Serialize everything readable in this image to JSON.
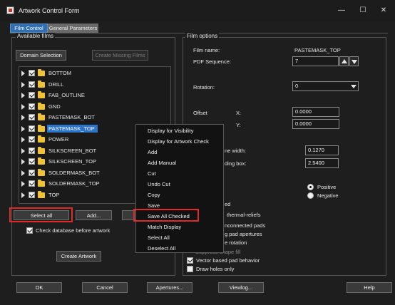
{
  "window": {
    "title": "Artwork Control Form",
    "minimize": "—",
    "maximize": "☐",
    "close": "✕"
  },
  "tabs": [
    "Film Control",
    "General Parameters"
  ],
  "available_films": {
    "legend": "Available films",
    "domain_selection": "Domain Selection",
    "create_missing": "Create Missing Films",
    "films": [
      "BOTTOM",
      "DRILL",
      "FAB_OUTLINE",
      "GND",
      "PASTEMASK_BOT",
      "PASTEMASK_TOP",
      "POWER",
      "SILKSCREEN_BOT",
      "SILKSCREEN_TOP",
      "SOLDERMASK_BOT",
      "SOLDERMASK_TOP",
      "TOP"
    ],
    "selected_film": "PASTEMASK_TOP",
    "select_all": "Select all",
    "add": "Add...",
    "check_database": "Check database before artwork",
    "create_artwork": "Create Artwork"
  },
  "film_options": {
    "legend": "Film options",
    "film_name_label": "Film name:",
    "film_name": "PASTEMASK_TOP",
    "pdf_sequence_label": "PDF Sequence:",
    "pdf_sequence": "7",
    "rotation_label": "Rotation:",
    "rotation": "0",
    "offset_label": "Offset",
    "x_label": "X:",
    "x_value": "0.0000",
    "y_label": "Y:",
    "y_value": "0.0000",
    "line_width_partial": "ne width:",
    "line_width": "0.1270",
    "bounding_partial": "ding box:",
    "bounding_box": "2.5400",
    "positive": "Positive",
    "negative": "Negative",
    "ed_partial": "ed",
    "thermal_partial": "thermal-reliefs",
    "unconnected_partial": "nconnected pads",
    "apertures_partial": "g pad apertures",
    "rotation_partial": "e rotation",
    "suppress_partial": "Suppress shape fill",
    "vector_pad": "Vector based pad behavior",
    "draw_holes": "Draw holes only"
  },
  "context_menu": [
    "Display for Visibility",
    "Display for Artwork Check",
    "Add",
    "Add Manual",
    "Cut",
    "Undo Cut",
    "Copy",
    "Save",
    "Save All Checked",
    "Match Display",
    "Select All",
    "Deselect All"
  ],
  "footer": {
    "ok": "OK",
    "cancel": "Cancel",
    "apertures": "Apertures...",
    "viewlog": "Viewlog...",
    "help": "Help"
  },
  "colors": {
    "selection": "#2c74c9",
    "highlight_box": "#e02a2a",
    "tab_active": "#2f6fb0"
  }
}
